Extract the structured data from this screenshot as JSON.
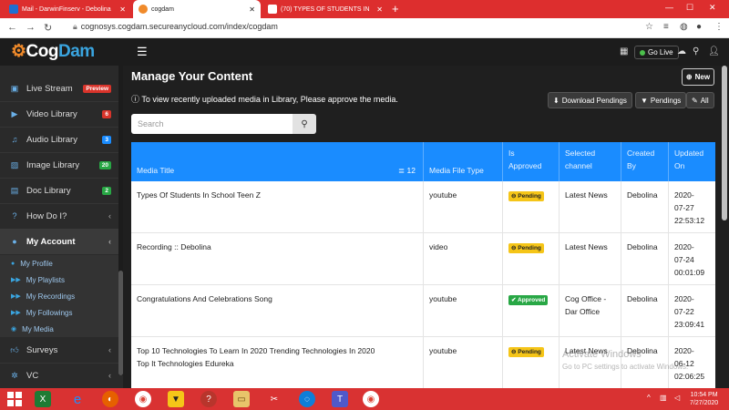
{
  "browser": {
    "tabs": [
      {
        "label": "Mail - DarwinFinserv - Debolina",
        "color": "#1f6fd1"
      },
      {
        "label": "cogdam",
        "color": "#f08a2a"
      },
      {
        "label": "(70) TYPES OF STUDENTS IN",
        "color": "#ff0000"
      }
    ],
    "url": "cognosys.cogdam.secureanycloud.com/index/cogdam"
  },
  "app": {
    "logo_part1": "Cog",
    "logo_part2": "Dam",
    "golive_label": "Go Live"
  },
  "sidebar": {
    "items": [
      {
        "label": "Live Stream",
        "icon": "video-camera-icon",
        "badge": "Preview",
        "badge_color": "#d9342b"
      },
      {
        "label": "Video Library",
        "icon": "film-icon",
        "badge": "6",
        "badge_color": "#d9342b"
      },
      {
        "label": "Audio Library",
        "icon": "music-icon",
        "badge": "3",
        "badge_color": "#1a8cff"
      },
      {
        "label": "Image Library",
        "icon": "image-icon",
        "badge": "20",
        "badge_color": "#28a745"
      },
      {
        "label": "Doc Library",
        "icon": "document-icon",
        "badge": "2",
        "badge_color": "#28a745"
      },
      {
        "label": "How Do I?",
        "icon": "question-icon"
      },
      {
        "label": "My Account",
        "icon": "user-icon"
      },
      {
        "label": "Surveys",
        "icon": "thumbs-up-icon"
      },
      {
        "label": "VC",
        "icon": "connection-icon"
      }
    ],
    "sub_items": [
      {
        "label": "My Profile",
        "icon": "profile-icon"
      },
      {
        "label": "My Playlists",
        "icon": "playlist-icon"
      },
      {
        "label": "My Recordings",
        "icon": "recording-icon"
      },
      {
        "label": "My Followings",
        "icon": "followings-icon"
      },
      {
        "label": "My Media",
        "icon": "media-icon"
      }
    ]
  },
  "main": {
    "title": "Manage Your Content",
    "new_label": "New",
    "info_text": "To view recently uploaded media in Library, Please approve the media.",
    "buttons": {
      "download": "Download Pendings",
      "pendings": "Pendings",
      "all": "All"
    },
    "search_placeholder": "Search",
    "table": {
      "headers": {
        "title": "Media Title",
        "count": "12",
        "type": "Media File Type",
        "approved_l1": "Is",
        "approved_l2": "Approved",
        "channel_l1": "Selected",
        "channel_l2": "channel",
        "created_l1": "Created",
        "created_l2": "By",
        "updated_l1": "Updated",
        "updated_l2": "On"
      },
      "rows": [
        {
          "title": "Types Of Students In School Teen Z",
          "type": "youtube",
          "status": "Pending",
          "channel": "Latest News",
          "created": "Debolina",
          "date": "2020-",
          "date2": "07-27",
          "time": "22:53:12"
        },
        {
          "title": "Recording :: Debolina",
          "type": "video",
          "status": "Pending",
          "channel": "Latest News",
          "created": "Debolina",
          "date": "2020-",
          "date2": "07-24",
          "time": "00:01:09"
        },
        {
          "title": "Congratulations And Celebrations Song",
          "type": "youtube",
          "status": "Approved",
          "channel": "Cog Office -",
          "channel2": "Dar Office",
          "created": "Debolina",
          "date": "2020-",
          "date2": "07-22",
          "time": "23:09:41"
        },
        {
          "title": "Top 10 Technologies To Learn In 2020 Trending Technologies In 2020",
          "title2": "Top It Technologies Edureka",
          "type": "youtube",
          "status": "Pending",
          "channel": "Latest News",
          "created": "Debolina",
          "date": "2020-",
          "date2": "06-12",
          "time": "02:06:25"
        }
      ]
    }
  },
  "watermark": {
    "line1": "Activate Windows",
    "line2": "Go to PC settings to activate Windows."
  },
  "taskbar": {
    "time": "10:54 PM",
    "date": "7/27/2020"
  }
}
